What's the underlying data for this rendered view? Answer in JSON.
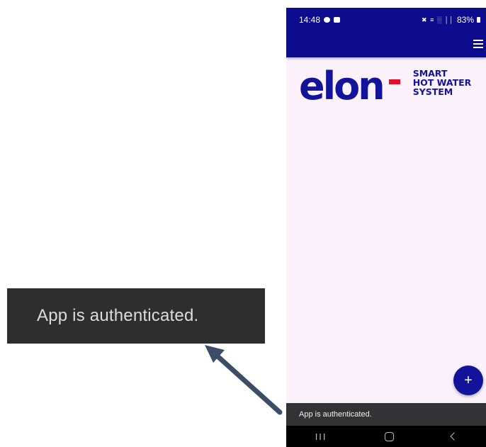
{
  "callout": {
    "text": "App is authenticated."
  },
  "phone": {
    "status_bar": {
      "time": "14:48",
      "signal_icons": "✖ ≡ ░ ││",
      "battery": "83%"
    },
    "logo": {
      "word": "elon",
      "tagline": [
        "SMART",
        "HOT WATER",
        "SYSTEM"
      ]
    },
    "fab_label": "+",
    "snackbar_text": "App is authenticated.",
    "nav": {
      "recent_label": "III"
    }
  },
  "colors": {
    "app_bar": "#0c0c8c",
    "brand_blue": "#12129a",
    "brand_red": "#e0102e",
    "background": "#fbf1fb",
    "snackbar": "#333336",
    "callout_bg": "#2e2e2e",
    "arrow": "#3d4d66"
  },
  "icons": [
    "message-icon",
    "calendar-icon",
    "mute-icon",
    "wifi-icon",
    "signal-icon",
    "battery-icon",
    "menu-icon",
    "plus-icon",
    "recent-apps-icon",
    "home-icon",
    "back-icon",
    "arrow-pointer"
  ]
}
